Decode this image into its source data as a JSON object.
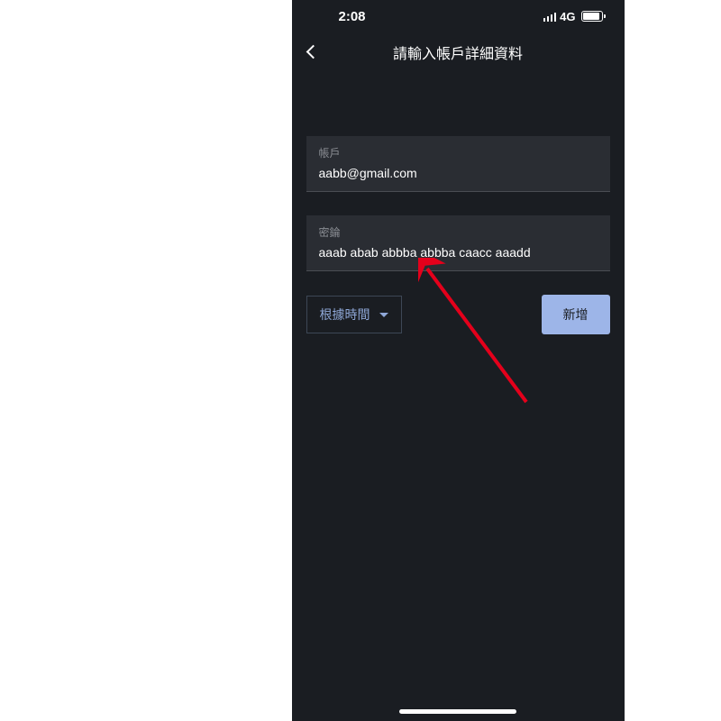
{
  "statusBar": {
    "time": "2:08",
    "network": "4G"
  },
  "nav": {
    "title": "請輸入帳戶詳細資料"
  },
  "fields": {
    "account": {
      "label": "帳戶",
      "value": "aabb@gmail.com"
    },
    "password": {
      "label": "密錀",
      "value": "aaab abab abbba abbba caacc aaadd"
    }
  },
  "actions": {
    "sortDropdown": "根據時間",
    "addButton": "新增"
  }
}
